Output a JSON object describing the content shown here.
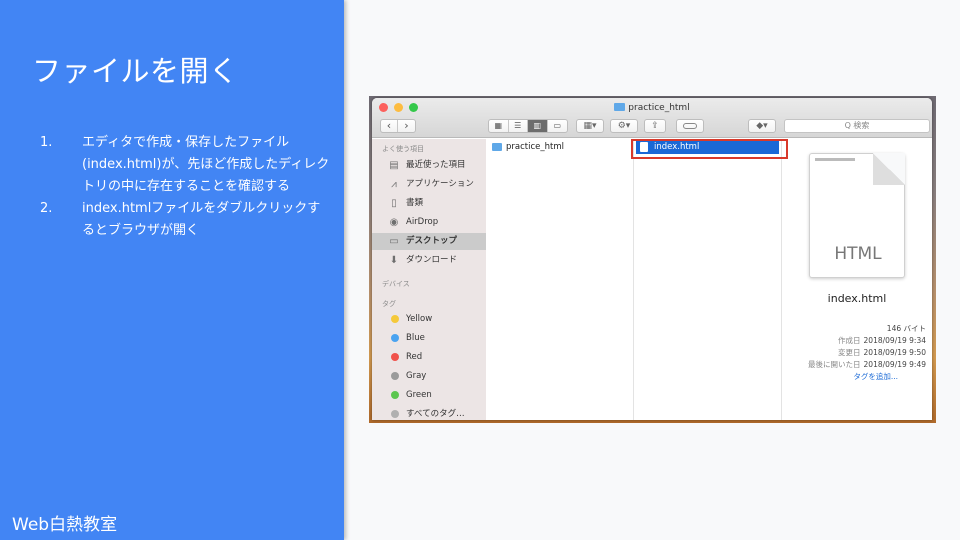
{
  "slide": {
    "title": "ファイルを開く",
    "steps": [
      {
        "num": "1.",
        "text": "エディタで作成・保存したファイル(index.html)が、先ほど作成したディレクトリの中に存在することを確認する"
      },
      {
        "num": "2.",
        "text": "index.htmlファイルをダブルクリックするとブラウザが開く"
      }
    ],
    "footer": "Web白熱教室"
  },
  "finder": {
    "window_title": "practice_html",
    "nav": {
      "back": "‹",
      "forward": "›"
    },
    "search_placeholder": "Q 検索",
    "sidebar": {
      "favorites_header": "よく使う項目",
      "favorites": [
        {
          "label": "最近使った項目",
          "icon": "recents-icon"
        },
        {
          "label": "アプリケーション",
          "icon": "applications-icon"
        },
        {
          "label": "書類",
          "icon": "documents-icon"
        },
        {
          "label": "AirDrop",
          "icon": "airdrop-icon"
        },
        {
          "label": "デスクトップ",
          "icon": "desktop-icon",
          "active": true
        },
        {
          "label": "ダウンロード",
          "icon": "downloads-icon"
        }
      ],
      "devices_header": "デバイス",
      "tags_header": "タグ",
      "tags": [
        {
          "label": "Yellow",
          "color": "#f5c93a"
        },
        {
          "label": "Blue",
          "color": "#4aa3f0"
        },
        {
          "label": "Red",
          "color": "#f0524b"
        },
        {
          "label": "Gray",
          "color": "#9a9a9a"
        },
        {
          "label": "Green",
          "color": "#5cc64f"
        },
        {
          "label": "すべてのタグ…",
          "color": "#b0b0b0"
        }
      ]
    },
    "column1": {
      "folder": "practice_html"
    },
    "column2": {
      "file": "index.html"
    },
    "preview": {
      "thumbnail_label": "HTML",
      "name": "index.html",
      "size": "146 バイト",
      "created_label": "作成日",
      "created": "2018/09/19 9:34",
      "modified_label": "変更日",
      "modified": "2018/09/19 9:50",
      "opened_label": "最後に開いた日",
      "opened": "2018/09/19 9:49",
      "add_tag": "タグを追加..."
    },
    "colors": {
      "accent": "#4285f4",
      "selection": "#1a68d6",
      "highlight": "#d8392b"
    }
  }
}
